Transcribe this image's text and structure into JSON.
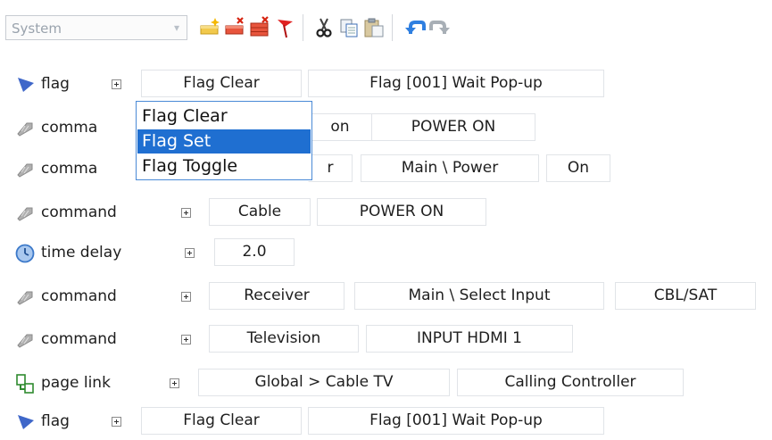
{
  "toolbar": {
    "system_combo_value": "System",
    "icons": [
      "add-icon",
      "delete-icon",
      "delete-all-icon",
      "flag-icon",
      "cut-icon",
      "copy-icon",
      "paste-icon",
      "undo-icon",
      "redo-icon"
    ]
  },
  "rows": [
    {
      "label": "flag",
      "icon": "flag-icon",
      "cells": [
        "Flag Clear",
        "Flag [001] Wait Pop-up"
      ]
    },
    {
      "label": "comma",
      "icon": "command-icon",
      "cells": [
        "on",
        "POWER ON"
      ]
    },
    {
      "label": "comma",
      "icon": "command-icon",
      "cells": [
        "r",
        "Main \\ Power",
        "On"
      ]
    },
    {
      "label": "command",
      "icon": "command-icon",
      "cells": [
        "Cable",
        "POWER ON"
      ]
    },
    {
      "label": "time delay",
      "icon": "clock-icon",
      "cells": [
        "2.0"
      ]
    },
    {
      "label": "command",
      "icon": "command-icon",
      "cells": [
        "Receiver",
        "Main \\ Select Input",
        "CBL/SAT"
      ]
    },
    {
      "label": "command",
      "icon": "command-icon",
      "cells": [
        "Television",
        "INPUT HDMI 1"
      ]
    },
    {
      "label": "page link",
      "icon": "page-link-icon",
      "cells": [
        "Global > Cable TV",
        "Calling Controller"
      ]
    },
    {
      "label": "flag",
      "icon": "flag-icon",
      "cells": [
        "Flag Clear",
        "Flag [001] Wait Pop-up"
      ]
    }
  ],
  "dropdown": {
    "options": [
      "Flag Clear",
      "Flag Set",
      "Flag Toggle"
    ],
    "selected": "Flag Set"
  },
  "colors": {
    "selection": "#1f6fd1",
    "flag_blue": "#3f67c9",
    "border": "#e1e4e8"
  }
}
